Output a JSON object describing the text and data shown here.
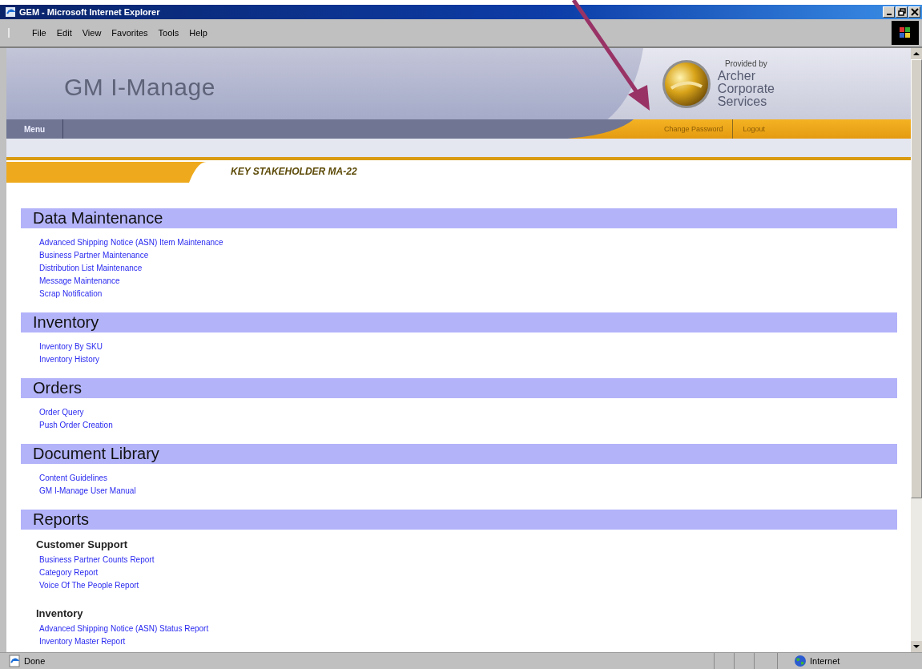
{
  "window": {
    "title": "GEM - Microsoft Internet Explorer"
  },
  "menu_bar": [
    "File",
    "Edit",
    "View",
    "Favorites",
    "Tools",
    "Help"
  ],
  "banner": {
    "app_title": "GM I-Manage",
    "provided_by": "Provided by",
    "company_lines": [
      "Archer",
      "Corporate",
      "Services"
    ]
  },
  "nav": {
    "menu": "Menu",
    "links": [
      "Change Password",
      "Logout"
    ]
  },
  "page_title": "KEY STAKEHOLDER MA-22",
  "sections": [
    {
      "title": "Data Maintenance",
      "links": [
        "Advanced Shipping Notice (ASN) Item Maintenance",
        "Business Partner Maintenance",
        "Distribution List Maintenance",
        "Message Maintenance",
        "Scrap Notification"
      ]
    },
    {
      "title": "Inventory",
      "links": [
        "Inventory By SKU",
        "Inventory History"
      ]
    },
    {
      "title": "Orders",
      "links": [
        "Order Query",
        "Push Order Creation"
      ]
    },
    {
      "title": "Document Library",
      "links": [
        "Content Guidelines",
        "GM I-Manage User Manual"
      ]
    },
    {
      "title": "Reports",
      "groups": [
        {
          "heading": "Customer Support",
          "links": [
            "Business Partner Counts Report",
            "Category Report",
            "Voice Of The People Report"
          ]
        },
        {
          "heading": "Inventory",
          "links": [
            "Advanced Shipping Notice (ASN) Status Report",
            "Inventory Master Report"
          ]
        }
      ]
    }
  ],
  "status_bar": {
    "status": "Done",
    "zone": "Internet"
  }
}
